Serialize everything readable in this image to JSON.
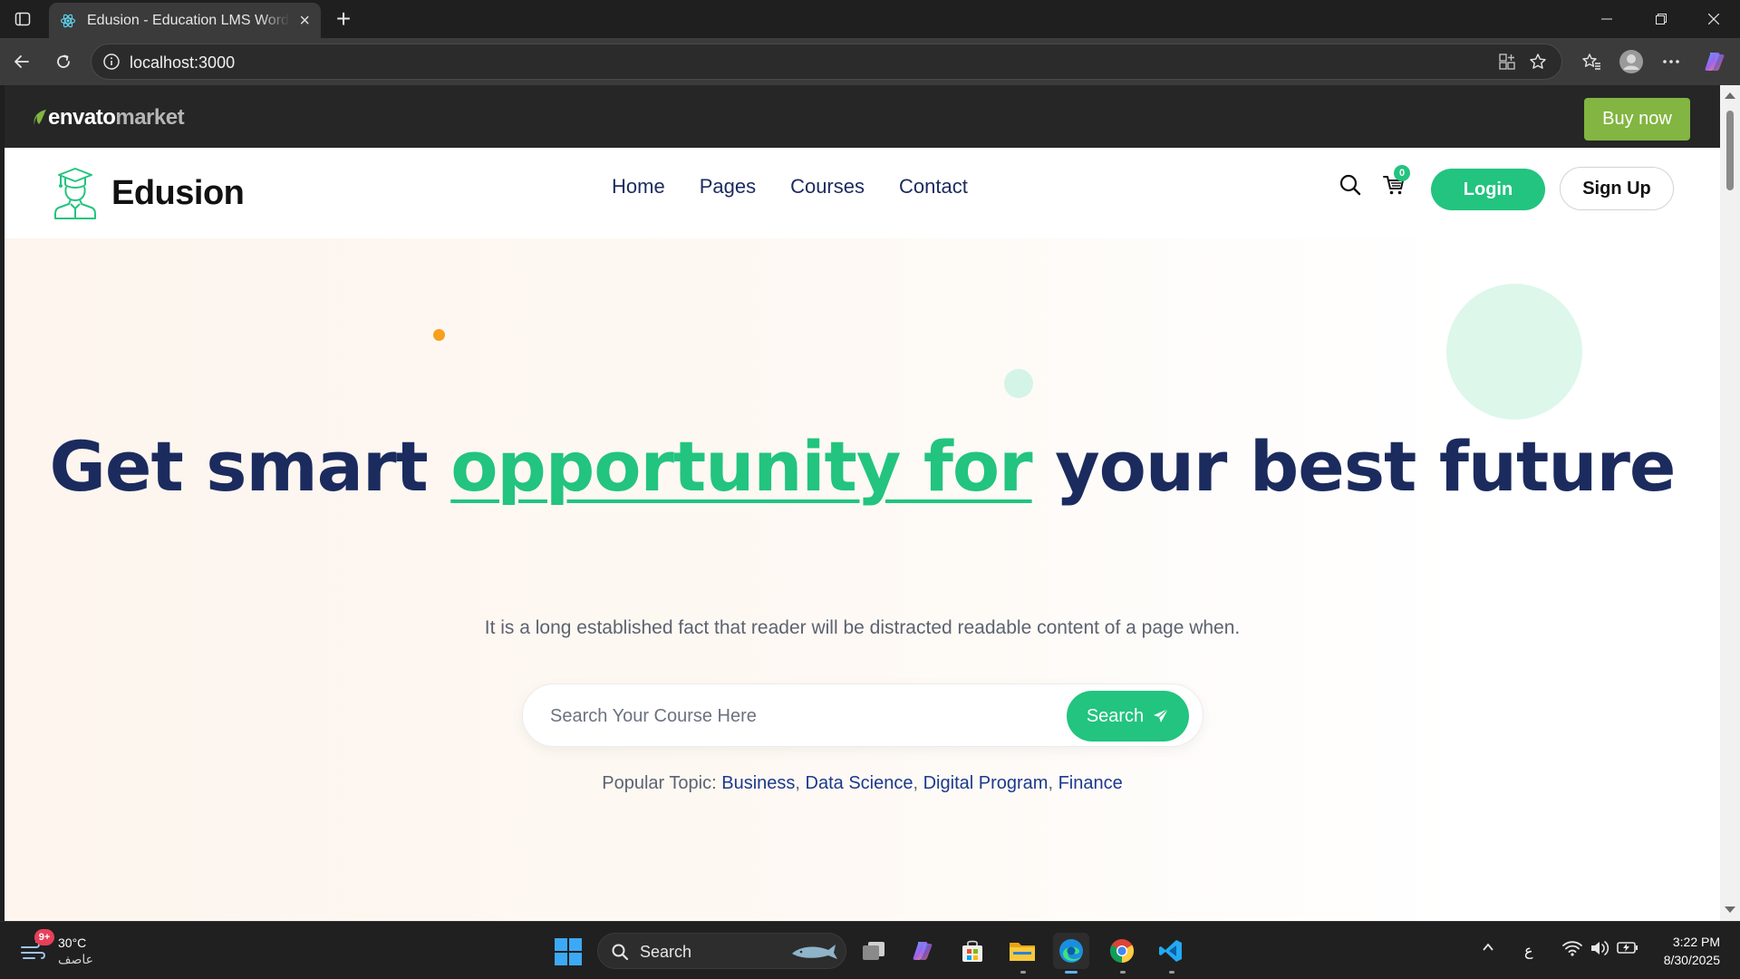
{
  "browser": {
    "tab_title": "Edusion - Education LMS WordPress Theme",
    "url": "localhost:3000"
  },
  "envato": {
    "logo_part1": "envato",
    "logo_part2": "market",
    "buy_now": "Buy now"
  },
  "header": {
    "brand": "Edusion",
    "nav": [
      "Home",
      "Pages",
      "Courses",
      "Contact"
    ],
    "cart_count": "0",
    "login": "Login",
    "signup": "Sign Up"
  },
  "hero": {
    "title_start": "Get smart ",
    "title_accent": "opportunity for",
    "title_end": " your best future",
    "subtitle": "It is a long established fact that reader will be distracted readable content of a page when.",
    "search_placeholder": "Search Your Course Here",
    "search_button": "Search",
    "popular_label": "Popular Topic:",
    "topics": [
      "Business",
      "Data Science",
      "Digital Program",
      "Finance"
    ]
  },
  "colors": {
    "brand_green": "#22c47f",
    "navy": "#1b2b5e",
    "envato_green": "#82b541",
    "accent_orange": "#f7a01c"
  },
  "taskbar": {
    "weather_temp": "30°C",
    "weather_desc": "عاصف",
    "weather_badge": "9+",
    "search_label": "Search",
    "time": "3:22 PM",
    "date": "8/30/2025",
    "input_lang": "ع"
  }
}
